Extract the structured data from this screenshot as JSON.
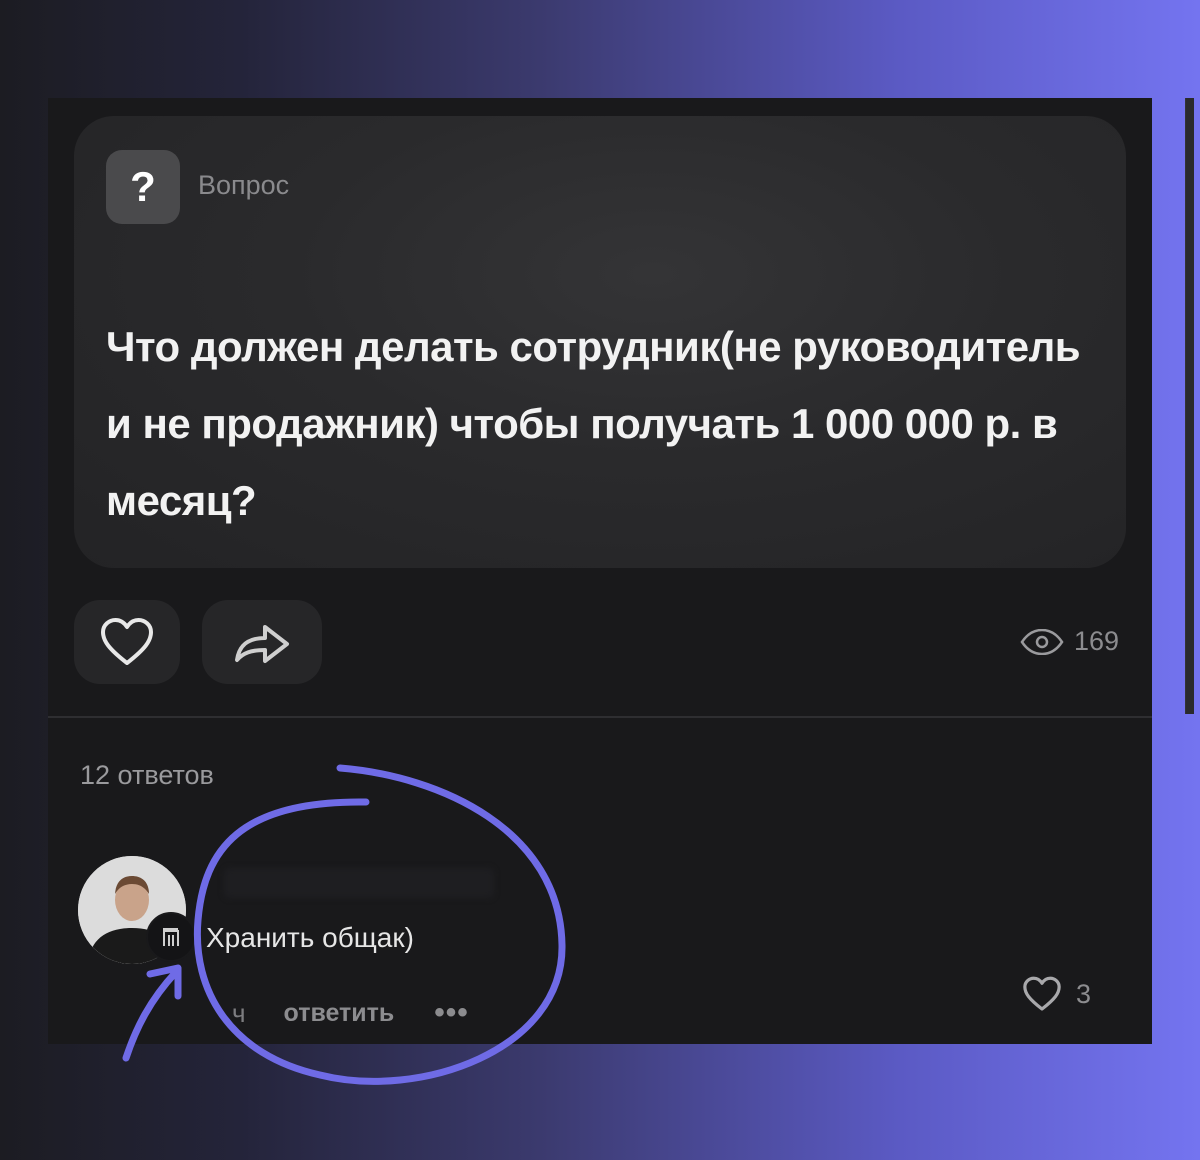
{
  "question": {
    "icon": "question-mark-icon",
    "icon_glyph": "?",
    "label": "Вопрос",
    "title": "Что должен делать сотрудник(не руководитель и не продажник) чтобы получать 1 000 000 р. в месяц?",
    "views": "169"
  },
  "actions": {
    "like_icon": "heart-icon",
    "share_icon": "share-arrow-icon",
    "views_icon": "eye-icon"
  },
  "answers": {
    "count_label": "12 ответов",
    "items": [
      {
        "text": "Хранить общак)",
        "time": "ч",
        "reply_label": "ответить",
        "more_label": "•••",
        "likes": "3"
      }
    ]
  },
  "colors": {
    "annotation": "#6f6be6",
    "panel": "#19191b",
    "card": "#2a2a2c"
  }
}
